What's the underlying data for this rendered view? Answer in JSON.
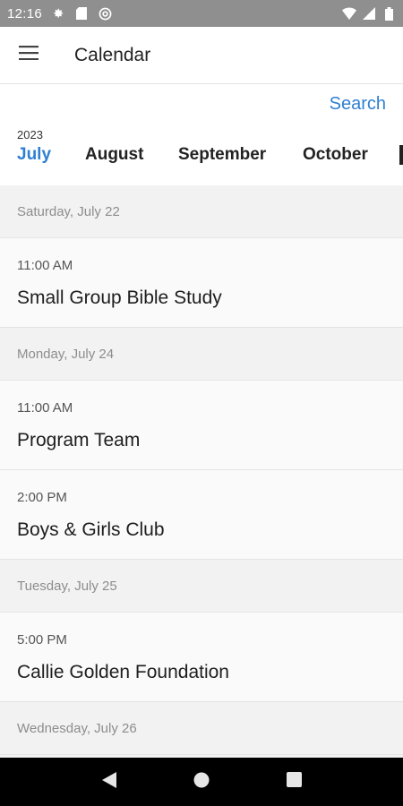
{
  "status_bar": {
    "time": "12:16"
  },
  "app_bar": {
    "title": "Calendar"
  },
  "header": {
    "search_label": "Search",
    "year": "2023",
    "months": [
      "July",
      "August",
      "September",
      "October"
    ],
    "active_month": "July"
  },
  "events": [
    {
      "date": "Saturday, July 22",
      "items": [
        {
          "time": "11:00 AM",
          "title": "Small Group Bible Study"
        }
      ]
    },
    {
      "date": "Monday, July 24",
      "items": [
        {
          "time": "11:00 AM",
          "title": "Program Team"
        },
        {
          "time": "2:00 PM",
          "title": "Boys & Girls Club"
        }
      ]
    },
    {
      "date": "Tuesday, July 25",
      "items": [
        {
          "time": "5:00 PM",
          "title": "Callie Golden Foundation"
        }
      ]
    },
    {
      "date": "Wednesday, July 26",
      "items": []
    }
  ],
  "colors": {
    "accent": "#2f80d1",
    "status_bar_bg": "#8f8f8f",
    "nav_bar_bg": "#000000",
    "date_header_bg": "#f2f2f2"
  },
  "icons": {
    "status_left": [
      "gear-icon",
      "sd-card-icon",
      "at-sign-icon"
    ],
    "status_right": [
      "wifi-icon",
      "signal-icon",
      "battery-icon"
    ],
    "app_bar": "menu-icon",
    "nav": [
      "back-icon",
      "home-icon",
      "recents-icon"
    ]
  }
}
